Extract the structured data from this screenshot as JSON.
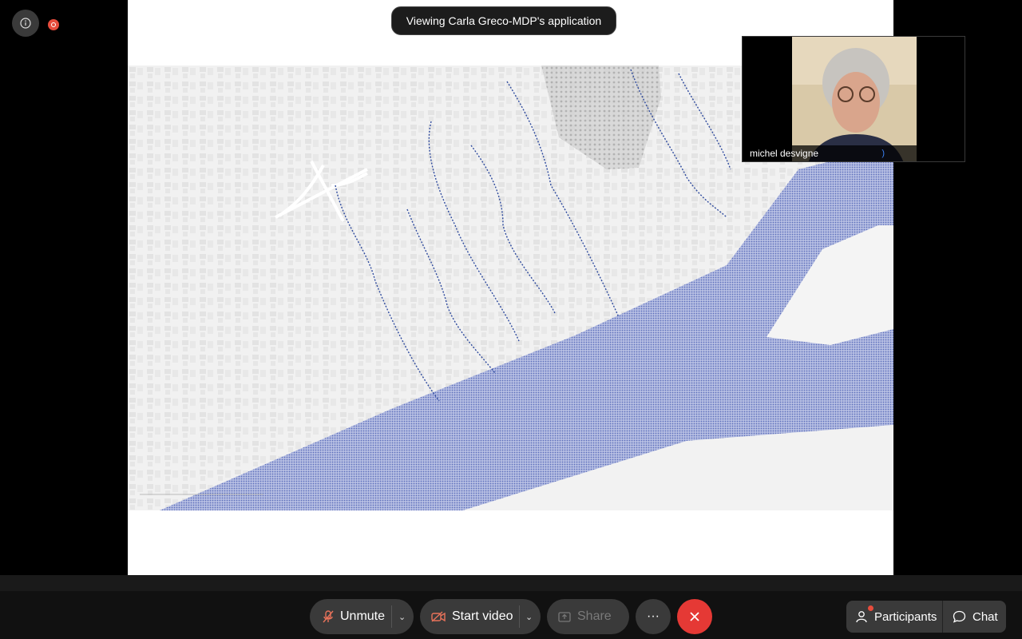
{
  "meeting": {
    "viewing_label": "Viewing Carla Greco-MDP's application",
    "colors": {
      "end_call": "#e53935",
      "recording": "#e74c3c",
      "map_water": "#6f7ec0",
      "route": "#2e4a9e"
    }
  },
  "participant_video": {
    "name": "michel desvigne"
  },
  "toolbar": {
    "unmute_label": "Unmute",
    "start_video_label": "Start video",
    "share_label": "Share",
    "more_label": "···",
    "participants_label": "Participants",
    "chat_label": "Chat"
  },
  "icons": [
    "info-icon",
    "recording-icon",
    "microphone-muted-icon",
    "camera-off-icon",
    "share-screen-icon",
    "more-icon",
    "end-call-icon",
    "participants-icon",
    "chat-icon",
    "chevron-down-icon"
  ]
}
